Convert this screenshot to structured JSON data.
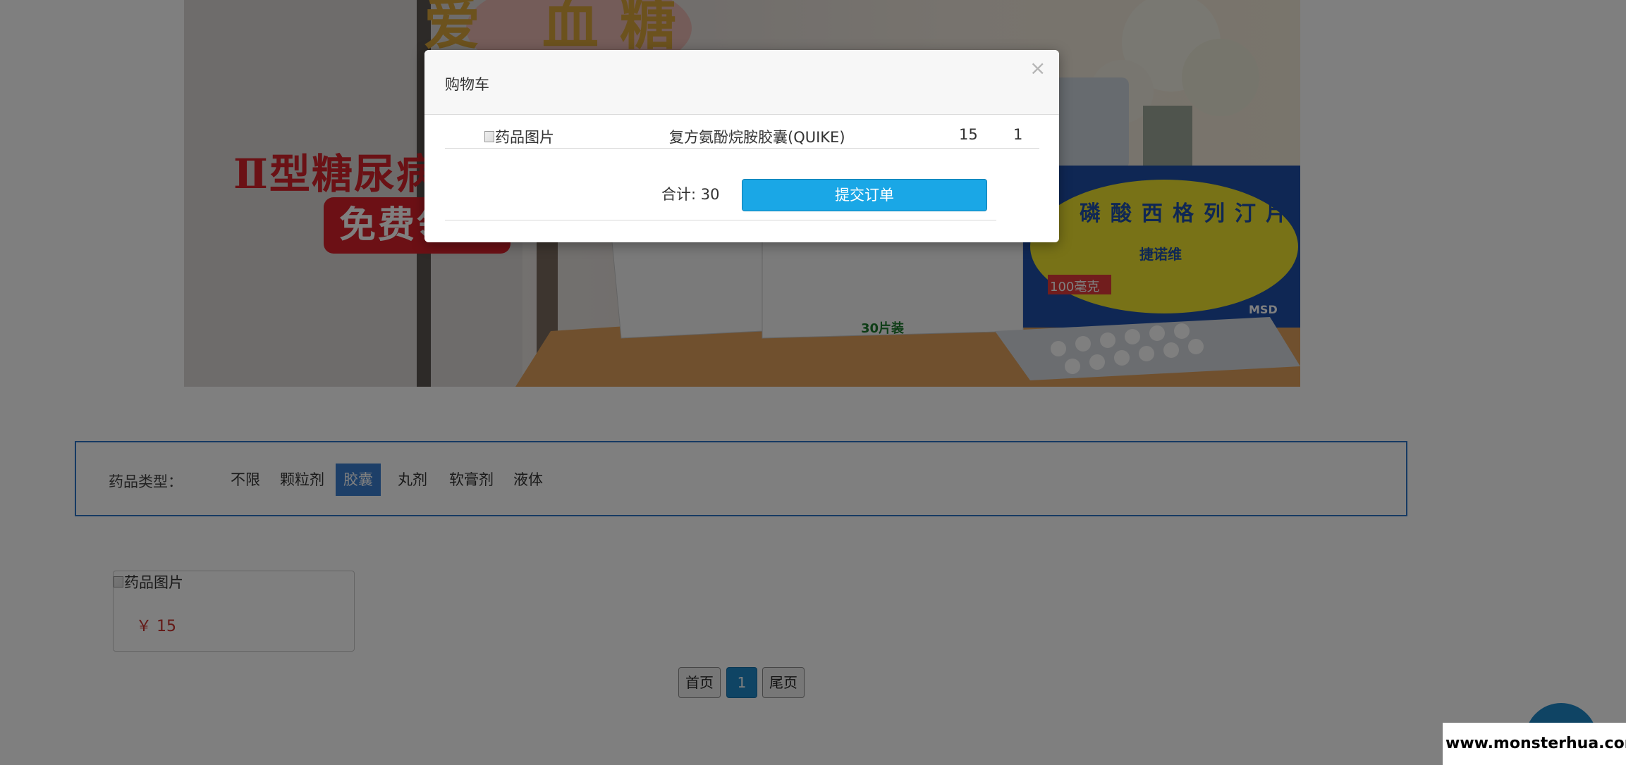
{
  "banner": {
    "top_text": "爱 血糖",
    "headline": "Ⅱ型糖尿病",
    "badge": "免费领",
    "product_box_text": "磷酸西格列汀片",
    "product_brand": "捷诺维",
    "product_dose": "100毫克",
    "product_pack": "30片装",
    "product_maker": "MSD"
  },
  "filter": {
    "label": "药品类型：",
    "options": [
      "不限",
      "颗粒剂",
      "胶囊",
      "丸剂",
      "软膏剂",
      "液体"
    ],
    "active": "胶囊"
  },
  "product": {
    "image_alt": "药品图片",
    "price": "￥ 15"
  },
  "pagination": {
    "first": "首页",
    "current": "1",
    "last": "尾页"
  },
  "watermark": "www.monsterhua.com",
  "cart_modal": {
    "title": "购物车",
    "close_symbol": "×",
    "items": [
      {
        "image_alt": "药品图片",
        "name": "复方氨酚烷胺胶囊(QUIKE)",
        "price": "15",
        "quantity": "1"
      }
    ],
    "total": "合计: 30",
    "submit_label": "提交订单"
  },
  "colors": {
    "accent": "#3a7fd1",
    "submit": "#1aa7e6",
    "price": "#c9302c",
    "pager_current": "#1e88c9"
  }
}
